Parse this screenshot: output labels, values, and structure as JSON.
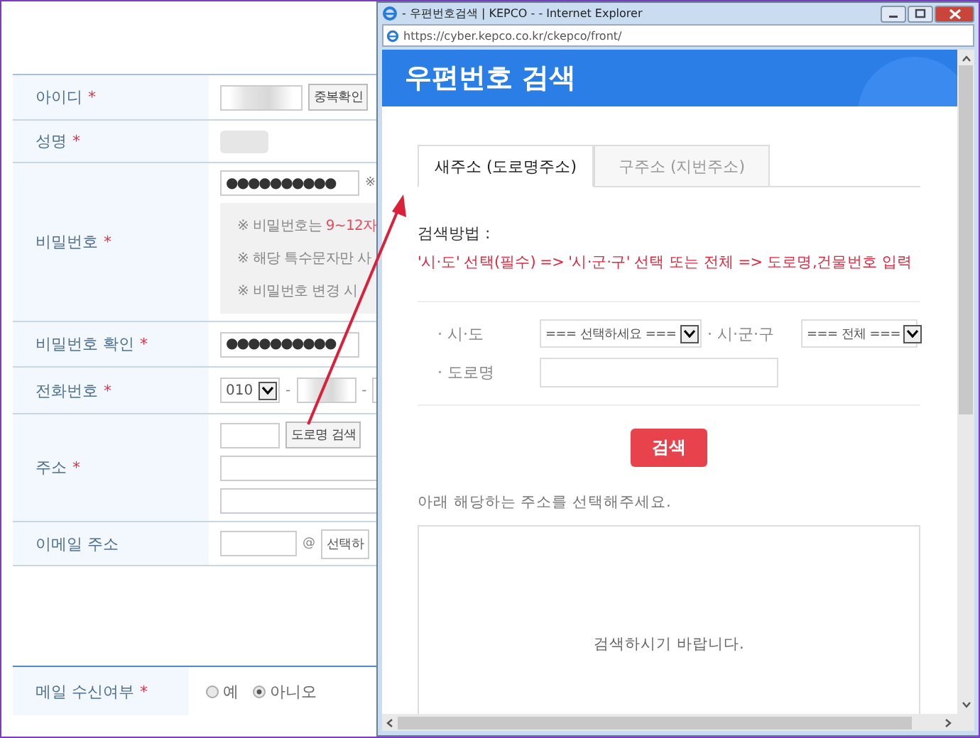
{
  "form": {
    "rows": [
      {
        "kind": "id",
        "label": "아이디",
        "required_mark": "*",
        "button": "중복확인"
      },
      {
        "kind": "redacted",
        "label": "성명",
        "required_mark": "*"
      },
      {
        "kind": "password",
        "label": "비밀번호",
        "required_mark": "*",
        "value": "●●●●●●●●●●",
        "note": "※",
        "hints": [
          {
            "text": "※ 비밀번호는 ",
            "emphasis": "9~12자"
          },
          {
            "text": "※ 해당 특수문자만 사"
          },
          {
            "text": "※ 비밀번호 변경 시"
          }
        ]
      },
      {
        "kind": "confirm",
        "label": "비밀번호 확인",
        "required_mark": "*",
        "value": "●●●●●●●●●●"
      },
      {
        "kind": "phone",
        "label": "전화번호",
        "required_mark": "*",
        "prefix": "010",
        "separator": "-"
      },
      {
        "kind": "address",
        "label": "주소",
        "required_mark": "*",
        "button": "도로명 검색"
      },
      {
        "kind": "email",
        "label": "이메일 주소",
        "at": "@",
        "domain": "선택하"
      }
    ],
    "mail": {
      "label": "메일 수신여부",
      "required_mark": "*",
      "options": [
        {
          "label": "예",
          "selected": false
        },
        {
          "label": "아니오",
          "selected": true
        }
      ]
    }
  },
  "popup": {
    "title": "- 우편번호검색 | KEPCO - - Internet Explorer",
    "url": "https://cyber.kepco.co.kr/ckepco/front/",
    "header": "우편번호 검색",
    "tabs": [
      {
        "label": "새주소 (도로명주소)",
        "selected": true
      },
      {
        "label": "구주소 (지번주소)",
        "selected": false
      }
    ],
    "method_label": "검색방법 :",
    "method": "'시·도' 선택(필수) => '시·군·구' 선택 또는 전체 => 도로명,건물번호 입력",
    "fields": [
      {
        "kind": "select",
        "label": "· 시·도",
        "value": "=== 선택하세요 ==="
      },
      {
        "kind": "select",
        "label": "· 시·군·구",
        "value": "=== 전체 ==="
      },
      {
        "kind": "input",
        "label": "· 도로명"
      }
    ],
    "search_button": "검색",
    "prompt": "아래 해당하는 주소를 선택해주세요.",
    "empty": "검색하시기 바랍니다."
  }
}
